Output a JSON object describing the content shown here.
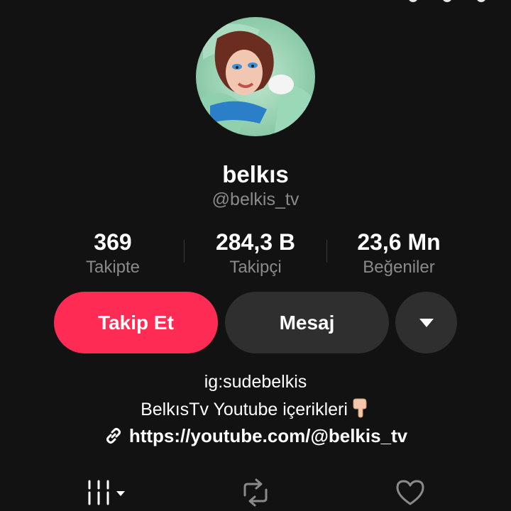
{
  "profile": {
    "display_name": "belkıs",
    "handle": "@belkis_tv"
  },
  "stats": [
    {
      "value": "369",
      "label": "Takipte"
    },
    {
      "value": "284,3 B",
      "label": "Takipçi"
    },
    {
      "value": "23,6 Mn",
      "label": "Beğeniler"
    }
  ],
  "actions": {
    "follow_label": "Takip Et",
    "message_label": "Mesaj",
    "more_icon": "caret-down-icon"
  },
  "bio": {
    "line1": "ig:sudebelkis",
    "line2": "BelkısTv Youtube içerikleri",
    "line2_emoji_icon": "hand-pointing-down-icon",
    "link_icon": "link-icon",
    "link": "https://youtube.com/@belkis_tv"
  },
  "tabs": [
    {
      "icon": "grid-videos-icon",
      "has_dropdown": true
    },
    {
      "icon": "repost-icon"
    },
    {
      "icon": "heart-outline-icon"
    }
  ],
  "colors": {
    "background": "#121212",
    "accent": "#fe2c55",
    "button_secondary": "#2f2f2f",
    "muted_text": "#8a8a8a"
  }
}
